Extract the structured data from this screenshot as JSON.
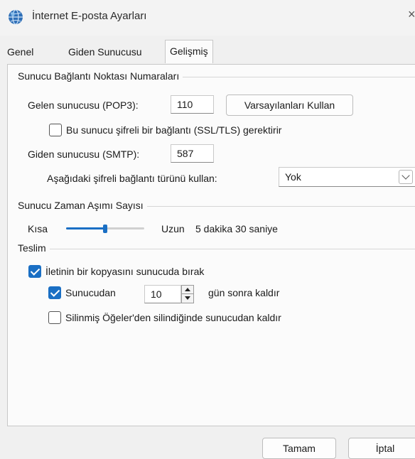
{
  "window": {
    "title": "İnternet E-posta Ayarları",
    "close_glyph": "×",
    "app_icon": "globe-icon"
  },
  "tabs": [
    {
      "label": "Genel",
      "active": false
    },
    {
      "label": "Giden Sunucusu",
      "active": false
    },
    {
      "label": "Gelişmiş",
      "active": true
    }
  ],
  "ports": {
    "group_title": "Sunucu Bağlantı Noktası Numaraları",
    "incoming_label": "Gelen sunucusu (POP3):",
    "incoming_value": "110",
    "defaults_button": "Varsayılanları Kullan",
    "ssl_checkbox_label": "Bu sunucu şifreli bir bağlantı (SSL/TLS) gerektirir",
    "ssl_checked": false,
    "outgoing_label": "Giden sunucusu (SMTP):",
    "outgoing_value": "587",
    "encryption_label": "Aşağıdaki şifreli bağlantı türünü kullan:",
    "encryption_value": "Yok"
  },
  "timeout": {
    "group_title": "Sunucu Zaman Aşımı Sayısı",
    "short_label": "Kısa",
    "long_label": "Uzun",
    "value_text": "5 dakika 30 saniye",
    "slider_fraction": 0.5
  },
  "delivery": {
    "group_title": "Teslim",
    "leave_copy_label": "İletinin bir kopyasını sunucuda bırak",
    "leave_copy_checked": true,
    "remove_after_label": "Sunucudan",
    "remove_after_checked": true,
    "days_value": "10",
    "days_suffix": "gün sonra kaldır",
    "remove_deleted_label": "Silinmiş Öğeler'den silindiğinde sunucudan kaldır",
    "remove_deleted_checked": false
  },
  "footer": {
    "ok_button": "Tamam",
    "cancel_button": "İptal"
  },
  "colors": {
    "accent": "#1a6fc4",
    "panel_bg": "#fbfbfb",
    "window_bg": "#f0f0f0"
  }
}
